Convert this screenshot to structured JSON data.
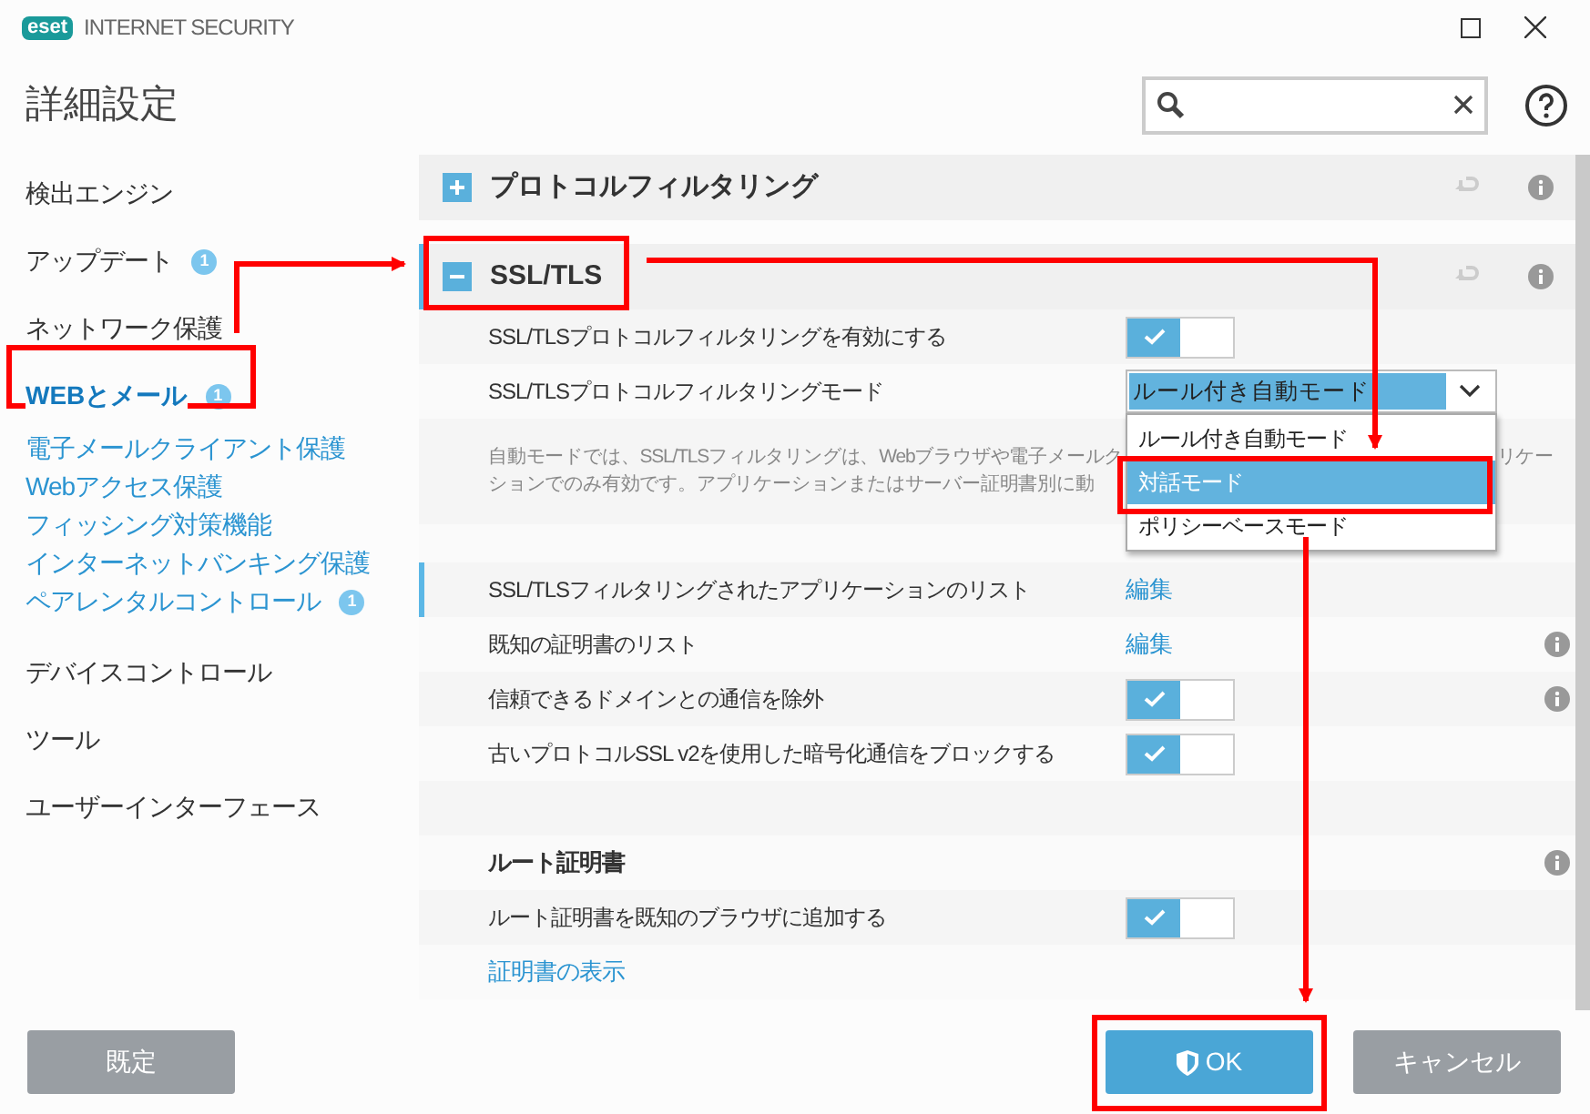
{
  "window": {
    "logo": "eset",
    "product": "INTERNET SECURITY"
  },
  "header": {
    "title": "詳細設定"
  },
  "sidebar": {
    "items": [
      {
        "label": "検出エンジン",
        "selected": false
      },
      {
        "label": "アップデート",
        "badge": "1",
        "selected": false
      },
      {
        "label": "ネットワーク保護",
        "selected": false
      },
      {
        "label": "WEBとメール",
        "badge": "1",
        "selected": true,
        "children": [
          {
            "label": "電子メールクライアント保護"
          },
          {
            "label": "Webアクセス保護"
          },
          {
            "label": "フィッシング対策機能"
          },
          {
            "label": "インターネットバンキング保護"
          },
          {
            "label": "ペアレンタルコントロール",
            "badge": "1"
          }
        ]
      },
      {
        "label": "デバイスコントロール",
        "selected": false
      },
      {
        "label": "ツール",
        "selected": false
      },
      {
        "label": "ユーザーインターフェース",
        "selected": false
      }
    ]
  },
  "sections": [
    {
      "title": "プロトコルフィルタリング",
      "expanded": false,
      "focused": false
    },
    {
      "title": "SSL/TLS",
      "expanded": true,
      "focused": true,
      "rows": [
        {
          "kind": "toggle",
          "label": "SSL/TLSプロトコルフィルタリングを有効にする",
          "on": true,
          "info": false,
          "focused": false
        },
        {
          "kind": "select",
          "label": "SSL/TLSプロトコルフィルタリングモード",
          "value": "ルール付き自動モード",
          "info": false,
          "focused": false,
          "options": [
            {
              "label": "ルール付き自動モード",
              "highlighted": false
            },
            {
              "label": "対話モード",
              "highlighted": true
            },
            {
              "label": "ポリシーベースモード",
              "highlighted": false
            }
          ]
        },
        {
          "kind": "description",
          "lines": [
            [
              "自動モードでは、SSL/TLSフィルタリングは、Webブラウザや電子メールク",
              "リケー"
            ],
            [
              "ションでのみ有効です。アプリケーションまたはサーバー証明書別に動"
            ]
          ]
        },
        {
          "kind": "spacer"
        },
        {
          "kind": "link",
          "label": "SSL/TLSフィルタリングされたアプリケーションのリスト",
          "action": "編集",
          "info": false,
          "focused": true
        },
        {
          "kind": "link",
          "label": "既知の証明書のリスト",
          "action": "編集",
          "info": true,
          "focused": false
        },
        {
          "kind": "toggle",
          "label": "信頼できるドメインとの通信を除外",
          "on": true,
          "info": true,
          "focused": false
        },
        {
          "kind": "toggle",
          "label": "古いプロトコルSSL v2を使用した暗号化通信をブロックする",
          "on": true,
          "info": false,
          "focused": false
        },
        {
          "kind": "spacer"
        },
        {
          "kind": "heading",
          "label": "ルート証明書",
          "info": true,
          "focused": false
        },
        {
          "kind": "toggle",
          "label": "ルート証明書を既知のブラウザに追加する",
          "on": true,
          "info": false,
          "focused": false
        },
        {
          "kind": "action",
          "label": "証明書の表示",
          "focused": false
        }
      ]
    }
  ],
  "footer": {
    "buttons": [
      {
        "label": "既定",
        "kind": "secondary"
      },
      {
        "label": "OK",
        "kind": "primary"
      },
      {
        "label": "キャンセル",
        "kind": "secondary"
      }
    ]
  }
}
